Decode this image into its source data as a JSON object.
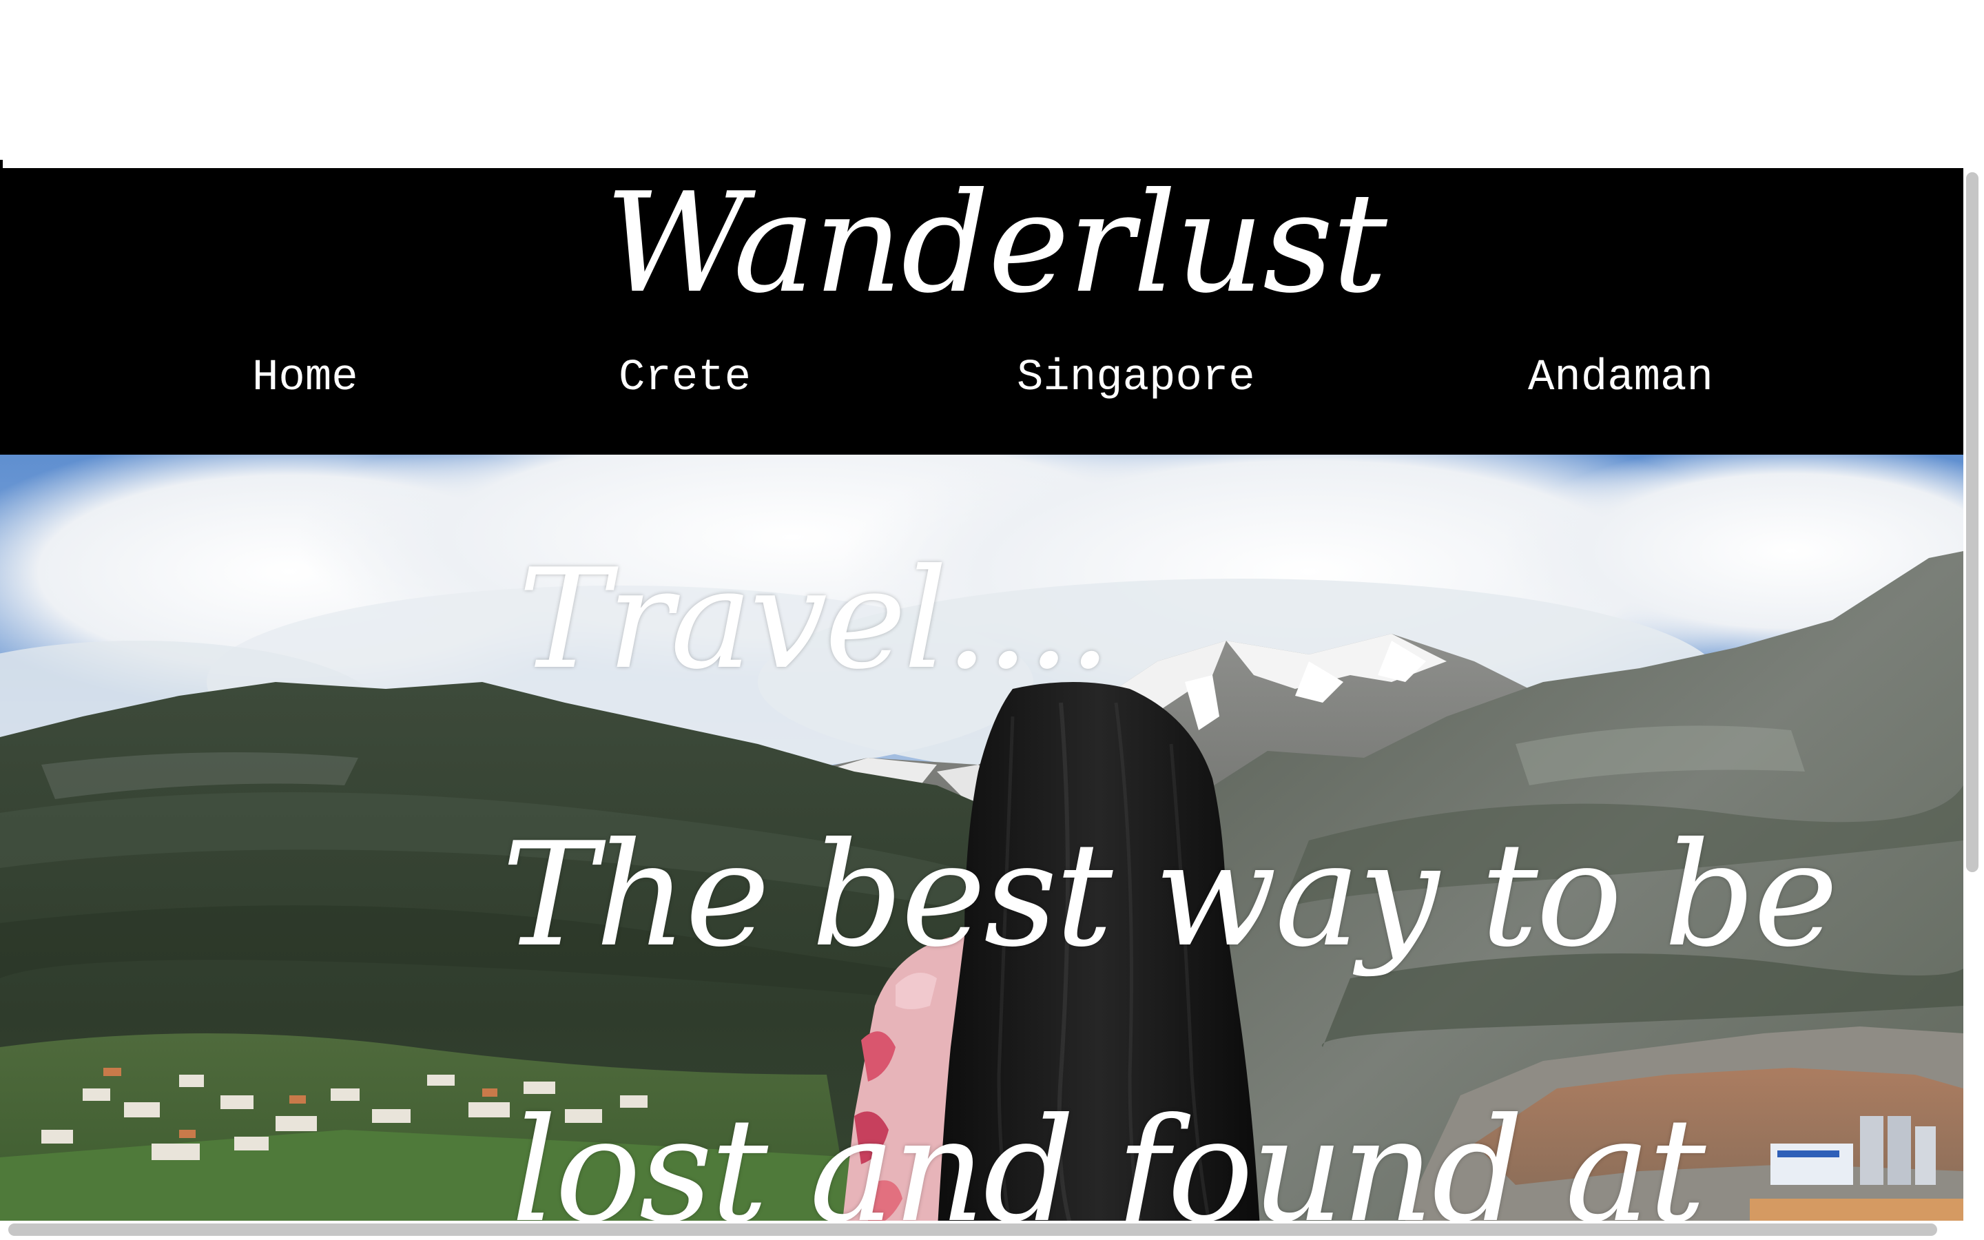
{
  "site": {
    "title": "Wanderlust"
  },
  "nav": {
    "items": [
      {
        "label": "Home"
      },
      {
        "label": "Crete"
      },
      {
        "label": "Singapore"
      },
      {
        "label": "Andaman"
      }
    ]
  },
  "hero": {
    "kicker": "Travel....",
    "quote_line_1": "The best way to be",
    "quote_line_2": "lost and found at"
  },
  "colors": {
    "header_background": "#000000",
    "header_text": "#ffffff",
    "hero_text": "#ffffff",
    "scrollbar_thumb": "#c6c6c6"
  }
}
